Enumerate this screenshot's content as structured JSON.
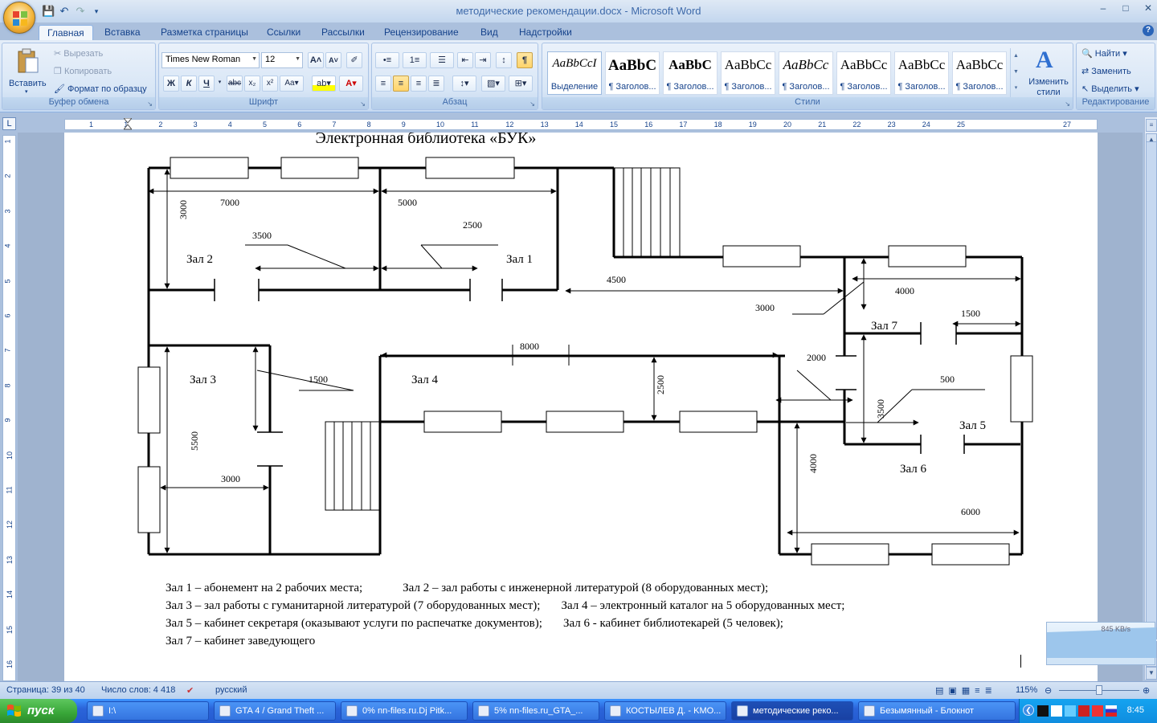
{
  "window": {
    "title": "методические рекомендации.docx - Microsoft Word",
    "controls": [
      "minimize-icon",
      "restore-icon",
      "close-icon"
    ]
  },
  "tabs": [
    "Главная",
    "Вставка",
    "Разметка страницы",
    "Ссылки",
    "Рассылки",
    "Рецензирование",
    "Вид",
    "Надстройки"
  ],
  "ribbon": {
    "clipboard": {
      "paste": "Вставить",
      "cut": "Вырезать",
      "copy": "Копировать",
      "format_painter": "Формат по образцу",
      "label": "Буфер обмена"
    },
    "font": {
      "name": "Times New Roman",
      "size": "12",
      "label": "Шрифт"
    },
    "paragraph": {
      "label": "Абзац"
    },
    "styles": {
      "label": "Стили",
      "items": [
        {
          "preview": "AaBbCcI",
          "name": "Выделение"
        },
        {
          "preview": "AaBbC",
          "name": "¶ Заголов..."
        },
        {
          "preview": "AaBbC",
          "name": "¶ Заголов..."
        },
        {
          "preview": "AaBbCс",
          "name": "¶ Заголов..."
        },
        {
          "preview": "AaBbCс",
          "name": "¶ Заголов..."
        },
        {
          "preview": "AaBbCс",
          "name": "¶ Заголов..."
        },
        {
          "preview": "AaBbCс",
          "name": "¶ Заголов..."
        },
        {
          "preview": "AaBbCс",
          "name": "¶ Заголов..."
        }
      ],
      "change": "Изменить стили"
    },
    "editing": {
      "find": "Найти",
      "replace": "Заменить",
      "select": "Выделить",
      "label": "Редактирование"
    }
  },
  "ruler": {
    "h_numbers": [
      "1",
      "1",
      "2",
      "3",
      "4",
      "5",
      "6",
      "7",
      "8",
      "9",
      "10",
      "11",
      "12",
      "13",
      "14",
      "15",
      "16",
      "17",
      "18",
      "19",
      "20",
      "21",
      "22",
      "23",
      "24",
      "25",
      "27"
    ],
    "v_numbers": [
      "1",
      "2",
      "3",
      "4",
      "5",
      "6",
      "7",
      "8",
      "9",
      "10",
      "11",
      "12",
      "13",
      "14",
      "15",
      "16"
    ]
  },
  "document": {
    "title": "Электронная  библиотека  «БУК»",
    "halls": {
      "h1": "Зал 1",
      "h2": "Зал 2",
      "h3": "Зал 3",
      "h4": "Зал 4",
      "h5": "Зал 5",
      "h6": "Зал 6",
      "h7": "Зал 7"
    },
    "dims": {
      "d7000": "7000",
      "d5000": "5000",
      "d3000a": "3000",
      "d3500a": "3500",
      "d2500a": "2500",
      "d4500": "4500",
      "d4000a": "4000",
      "d3000b": "3000",
      "d1500a": "1500",
      "d8000": "8000",
      "d2000": "2000",
      "d1500b": "1500",
      "d2500b": "2500",
      "d500": "500",
      "d3500b": "3500",
      "d5500": "5500",
      "d3000c": "3000",
      "d4000b": "4000",
      "d6000": "6000"
    },
    "legend": [
      [
        "Зал 1 – абонемент на 2 рабочих места;",
        "Зал 2 – зал работы с инженерной литературой (8 оборудованных мест);"
      ],
      [
        "Зал 3 – зал работы с гуманитарной литературой (7 оборудованных мест);",
        "Зал 4 – электронный каталог на 5 оборудованных мест;"
      ],
      [
        "Зал 5 – кабинет секретаря (оказывают услуги по распечатке документов);",
        "Зал 6 -   кабинет библиотекарей (5  человек);"
      ],
      [
        "Зал 7 – кабинет заведующего",
        ""
      ]
    ]
  },
  "netmeter": {
    "speed": "845 KB/s"
  },
  "status": {
    "page": "Страница: 39 из 40",
    "words": "Число слов: 4 418",
    "lang": "русский",
    "zoom": "115%"
  },
  "taskbar": {
    "start": "пуск",
    "items": [
      "I:\\",
      "GTA 4 / Grand Theft ...",
      "0% nn-files.ru.Dj Pitk...",
      "5% nn-files.ru_GTA_...",
      "КОСТЫЛЕВ Д. - KMO...",
      "методические реко...",
      "Безымянный - Блокнот"
    ],
    "clock": "8:45"
  }
}
